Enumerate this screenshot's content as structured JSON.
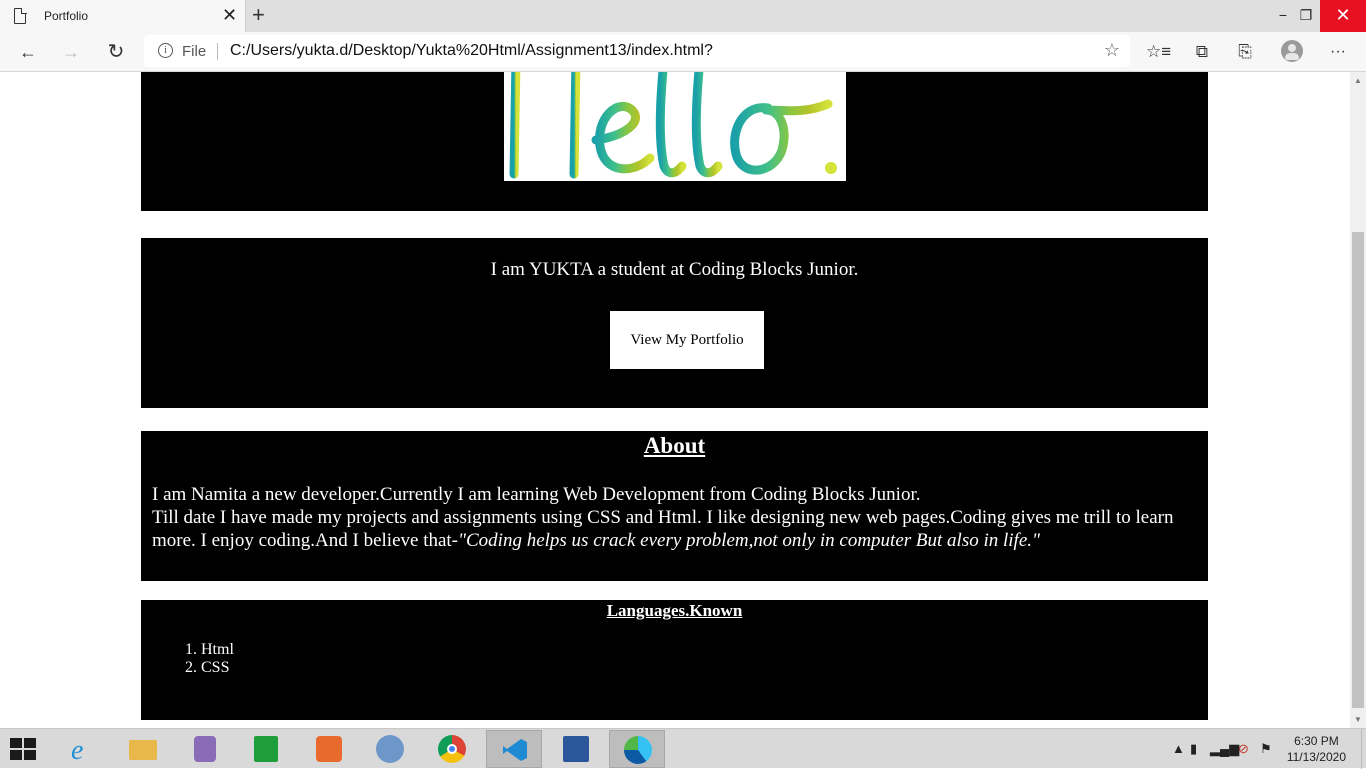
{
  "browser": {
    "tab_title": "Portfolio",
    "url_scheme_label": "File",
    "url": "C:/Users/yukta.d/Desktop/Yukta%20Html/Assignment13/index.html?",
    "icons": {
      "close_tab": "✕",
      "new_tab": "+",
      "back": "←",
      "forward": "→",
      "refresh": "↻",
      "favorite": "☆",
      "favorites": "☆≡",
      "collections": "⧉",
      "share": "⎘",
      "more": "···",
      "minimize": "−",
      "restore": "❐",
      "close_window": "✕"
    }
  },
  "page": {
    "hero": {
      "image_alt": "Hello."
    },
    "intro": {
      "text": "I am YUKTA a student at Coding Blocks Junior.",
      "button_label": "View My Portfolio"
    },
    "about": {
      "heading": "About",
      "line1": "I am Namita a new developer.Currently I am learning Web Development from Coding Blocks Junior.",
      "line2_plain": "Till date I have made my projects and assignments using CSS and Html. I like designing new web pages.Coding gives me trill to learn more. I enjoy coding.And I believe that-",
      "quote": "\"Coding helps us crack every problem,not only in computer But also in life.\""
    },
    "languages": {
      "heading": "Languages.Known",
      "items": [
        "Html",
        "CSS"
      ]
    }
  },
  "taskbar": {
    "apps": [
      "internet-explorer",
      "file-explorer",
      "media-player",
      "store",
      "office",
      "math-input",
      "chrome",
      "vscode",
      "word",
      "edge"
    ],
    "clock_time": "6:30 PM",
    "clock_date": "11/13/2020"
  },
  "colors": {
    "panel_bg": "#000000",
    "panel_text": "#ffffff",
    "close_red": "#e81123"
  }
}
